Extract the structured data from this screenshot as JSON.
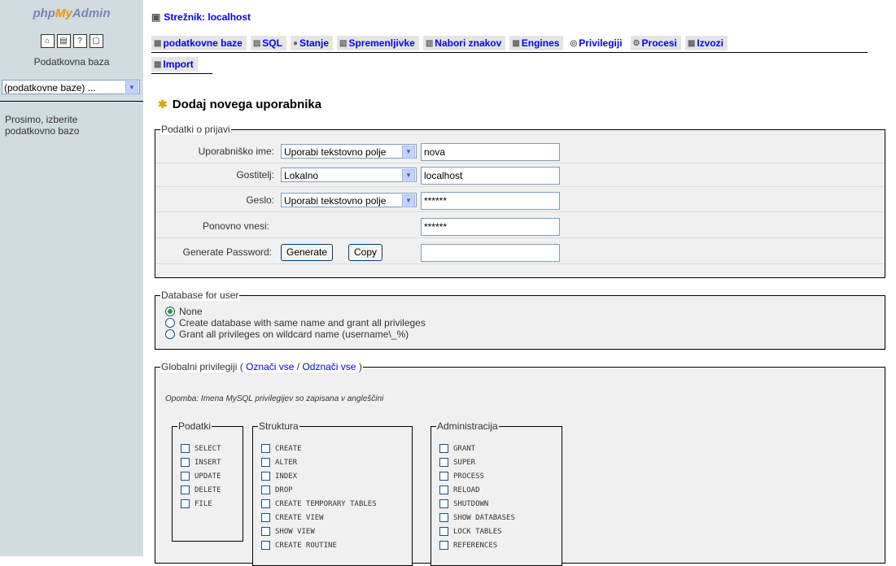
{
  "logo": {
    "php": "php",
    "my": "My",
    "admin": "Admin"
  },
  "left": {
    "db_label": "Podatkovna baza",
    "db_select": "(podatkovne baze) ...",
    "hint_line1": "Prosimo, izberite",
    "hint_line2": "podatkovno bazo"
  },
  "server": {
    "label": "Strežnik: localhost"
  },
  "tabs": [
    {
      "label": "podatkovne baze"
    },
    {
      "label": "SQL"
    },
    {
      "label": "Stanje"
    },
    {
      "label": "Spremenljivke"
    },
    {
      "label": "Nabori znakov"
    },
    {
      "label": "Engines"
    },
    {
      "label": "Privilegiji"
    },
    {
      "label": "Procesi"
    },
    {
      "label": "Izvozi"
    },
    {
      "label": "Import"
    }
  ],
  "page": {
    "title": "Dodaj novega uporabnika"
  },
  "login": {
    "legend": "Podatki o prijavi",
    "username_label": "Uporabniško ime:",
    "username_mode": "Uporabi tekstovno polje",
    "username_value": "nova",
    "host_label": "Gostitelj:",
    "host_mode": "Lokalno",
    "host_value": "localhost",
    "password_label": "Geslo:",
    "password_mode": "Uporabi tekstovno polje",
    "password_value": "******",
    "retype_label": "Ponovno vnesi:",
    "retype_value": "******",
    "generate_label": "Generate Password:",
    "generate_button": "Generate",
    "copy_button": "Copy",
    "generated_value": ""
  },
  "dbuser": {
    "legend": "Database for user",
    "opt_none": "None",
    "opt_same": "Create database with same name and grant all privileges",
    "opt_wild": "Grant all privileges on wildcard name (username\\_%)"
  },
  "global": {
    "legend_prefix": "Globalni privilegiji (",
    "check_all": "Označi vse",
    "sep": "/",
    "uncheck_all": "Odznači vse",
    "legend_suffix": ")",
    "note": "Opomba: Imena MySQL privilegijev so zapisana v angleščini",
    "data_legend": "Podatki",
    "data_items": [
      "SELECT",
      "INSERT",
      "UPDATE",
      "DELETE",
      "FILE"
    ],
    "struct_legend": "Struktura",
    "struct_items": [
      "CREATE",
      "ALTER",
      "INDEX",
      "DROP",
      "CREATE TEMPORARY TABLES",
      "CREATE VIEW",
      "SHOW VIEW",
      "CREATE ROUTINE"
    ],
    "admin_legend": "Administracija",
    "admin_items": [
      "GRANT",
      "SUPER",
      "PROCESS",
      "RELOAD",
      "SHUTDOWN",
      "SHOW DATABASES",
      "LOCK TABLES",
      "REFERENCES"
    ]
  }
}
